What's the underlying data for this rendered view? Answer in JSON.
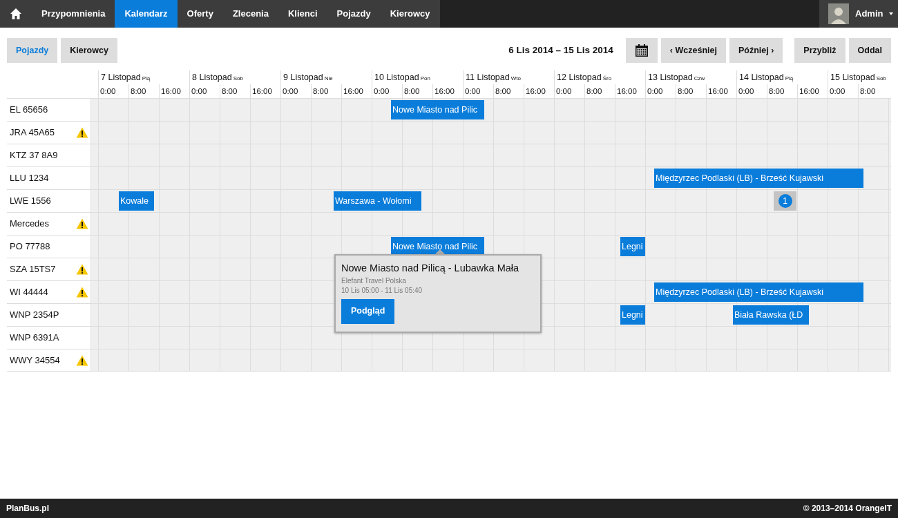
{
  "navbar": {
    "items": [
      {
        "label": "Przypomnienia",
        "selected": false
      },
      {
        "label": "Kalendarz",
        "selected": true
      },
      {
        "label": "Oferty",
        "selected": false
      },
      {
        "label": "Zlecenia",
        "selected": false
      },
      {
        "label": "Klienci",
        "selected": false
      },
      {
        "label": "Pojazdy",
        "selected": false
      },
      {
        "label": "Kierowcy",
        "selected": false
      }
    ],
    "user": "Admin"
  },
  "view_tabs": [
    {
      "label": "Pojazdy",
      "selected": true
    },
    {
      "label": "Kierowcy",
      "selected": false
    }
  ],
  "date_range": "6 Lis 2014 – 15 Lis 2014",
  "buttons": [
    "‹ Wcześniej",
    "Później ›",
    "Przybliż",
    "Oddal"
  ],
  "days": [
    {
      "date": "7 Listopad",
      "weekday": "Pią",
      "hours": [
        "0:00",
        "8:00",
        "16:00"
      ]
    },
    {
      "date": "8 Listopad",
      "weekday": "Sob",
      "hours": [
        "0:00",
        "8:00",
        "16:00"
      ]
    },
    {
      "date": "9 Listopad",
      "weekday": "Nie",
      "hours": [
        "0:00",
        "8:00",
        "16:00"
      ]
    },
    {
      "date": "10 Listopad",
      "weekday": "Pon",
      "hours": [
        "0:00",
        "8:00",
        "16:00"
      ]
    },
    {
      "date": "11 Listopad",
      "weekday": "Wto",
      "hours": [
        "0:00",
        "8:00",
        "16:00"
      ]
    },
    {
      "date": "12 Listopad",
      "weekday": "Śro",
      "hours": [
        "0:00",
        "8:00",
        "16:00"
      ]
    },
    {
      "date": "13 Listopad",
      "weekday": "Czw",
      "hours": [
        "0:00",
        "8:00",
        "16:00"
      ]
    },
    {
      "date": "14 Listopad",
      "weekday": "Pią",
      "hours": [
        "0:00",
        "8:00",
        "16:00"
      ]
    },
    {
      "date": "15 Listopad",
      "weekday": "Sob",
      "hours": [
        "0:00",
        "8:00"
      ]
    }
  ],
  "vehicles": [
    {
      "name": "EL 65656",
      "warning": false,
      "events": [
        {
          "kind": "trip",
          "label": "Nowe Miasto nad Pilic"
        }
      ]
    },
    {
      "name": "JRA 45A65",
      "warning": true
    },
    {
      "name": "KTZ 37 8A9",
      "warning": false
    },
    {
      "name": "LLU 1234",
      "warning": false,
      "events": [
        {
          "kind": "trip",
          "label": "Międzyrzec Podlaski (LB) - Brześć Kujawski"
        }
      ]
    },
    {
      "name": "LWE 1556",
      "warning": false,
      "events": [
        {
          "kind": "trip",
          "label": "Kowale"
        },
        {
          "kind": "trip",
          "label": "Warszawa - Wołomi"
        },
        {
          "kind": "count",
          "label": "1"
        }
      ]
    },
    {
      "name": "Mercedes",
      "warning": true
    },
    {
      "name": "PO 77788",
      "warning": false,
      "events": [
        {
          "kind": "trip",
          "label": "Nowe Miasto nad Pilic"
        },
        {
          "kind": "trip",
          "label": "Legni"
        }
      ]
    },
    {
      "name": "SZA 15TS7",
      "warning": true
    },
    {
      "name": "WI 44444",
      "warning": true,
      "events": [
        {
          "kind": "trip",
          "label": "Międzyrzec Podlaski (LB) - Brześć Kujawski"
        }
      ]
    },
    {
      "name": "WNP 2354P",
      "warning": false,
      "events": [
        {
          "kind": "trip",
          "label": "Legni"
        },
        {
          "kind": "trip",
          "label": "Biała Rawska (ŁD"
        }
      ]
    },
    {
      "name": "WNP 6391A",
      "warning": false
    },
    {
      "name": "WWY 34554",
      "warning": true
    }
  ],
  "popover": {
    "title": "Nowe Miasto nad Pilicą - Lubawka Mała",
    "company": "Elefant Travel Polska",
    "time": "10 Lis 05:00 - 11 Lis 05:40",
    "button": "Podgląd"
  },
  "footer": {
    "brand": "PlanBus.pl",
    "copyright": "© 2013–2014 OrangeIT"
  }
}
